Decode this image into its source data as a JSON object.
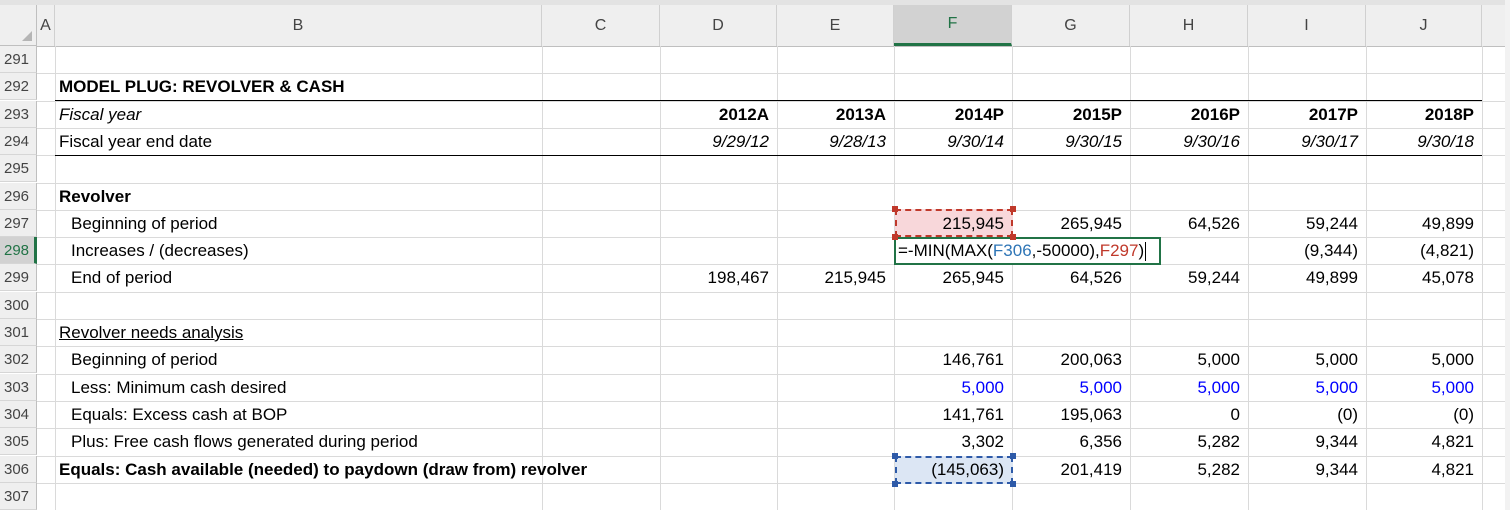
{
  "columns": [
    "A",
    "B",
    "C",
    "D",
    "E",
    "F",
    "G",
    "H",
    "I",
    "J"
  ],
  "active_column": "F",
  "row_numbers": [
    "291",
    "292",
    "293",
    "294",
    "295",
    "296",
    "297",
    "298",
    "299",
    "300",
    "301",
    "302",
    "303",
    "304",
    "305",
    "306",
    "307"
  ],
  "active_row": "298",
  "section_title": "MODEL PLUG: REVOLVER & CASH",
  "fiscal_year_label": "Fiscal year",
  "fiscal_years": [
    "2012A",
    "2013A",
    "2014P",
    "2015P",
    "2016P",
    "2017P",
    "2018P"
  ],
  "fy_end_label": "Fiscal year end date",
  "fy_end_dates": [
    "9/29/12",
    "9/28/13",
    "9/30/14",
    "9/30/15",
    "9/30/16",
    "9/30/17",
    "9/30/18"
  ],
  "revolver": {
    "title": "Revolver",
    "beginning_label": "Beginning of period",
    "beginning": [
      "",
      "",
      "215,945",
      "265,945",
      "64,526",
      "59,244",
      "49,899"
    ],
    "increases_label": "Increases / (decreases)",
    "increases": [
      "",
      "",
      "",
      "",
      "",
      "(9,344)",
      "(4,821)"
    ],
    "end_label": "End of period",
    "end": [
      "198,467",
      "215,945",
      "265,945",
      "64,526",
      "59,244",
      "49,899",
      "45,078"
    ]
  },
  "formula_edit": {
    "prefix": "=-MIN(MAX(",
    "ref1": "F306",
    "middle": ",-50000),",
    "ref2": "F297",
    "suffix": ")"
  },
  "analysis": {
    "title": "Revolver needs analysis",
    "bop_label": "Beginning of period",
    "bop": [
      "",
      "",
      "146,761",
      "200,063",
      "5,000",
      "5,000",
      "5,000"
    ],
    "min_cash_label": "Less: Minimum cash desired",
    "min_cash": [
      "",
      "",
      "5,000",
      "5,000",
      "5,000",
      "5,000",
      "5,000"
    ],
    "excess_label": "Equals: Excess cash at BOP",
    "excess": [
      "",
      "",
      "141,761",
      "195,063",
      "0",
      "(0)",
      "(0)"
    ],
    "fcf_label": "Plus: Free cash flows generated during period",
    "fcf": [
      "",
      "",
      "3,302",
      "6,356",
      "5,282",
      "9,344",
      "4,821"
    ],
    "available_label": "Equals: Cash available (needed) to paydown (draw from) revolver",
    "available": [
      "",
      "",
      "(145,063)",
      "201,419",
      "5,282",
      "9,344",
      "4,821"
    ]
  },
  "colors": {
    "accent_green": "#217346",
    "input_blue": "#0000ff",
    "ref_blue": "#2e75b6",
    "ref_red": "#c0392b"
  }
}
